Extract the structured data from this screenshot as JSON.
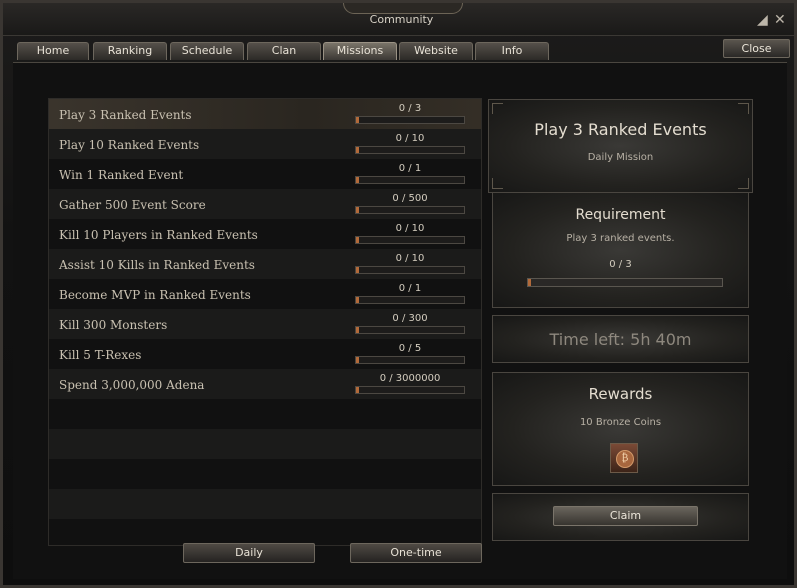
{
  "window": {
    "title": "Community",
    "minimize_glyph": "◢",
    "close_glyph": "✕"
  },
  "tabs": [
    {
      "label": "Home"
    },
    {
      "label": "Ranking"
    },
    {
      "label": "Schedule"
    },
    {
      "label": "Clan"
    },
    {
      "label": "Missions",
      "active": true
    },
    {
      "label": "Website"
    },
    {
      "label": "Info"
    }
  ],
  "close_button": {
    "label": "Close"
  },
  "missions": [
    {
      "name": "Play 3 Ranked Events",
      "progress": "0 / 3",
      "fraction": 0
    },
    {
      "name": "Play 10 Ranked Events",
      "progress": "0 / 10",
      "fraction": 0
    },
    {
      "name": "Win 1 Ranked Event",
      "progress": "0 / 1",
      "fraction": 0
    },
    {
      "name": "Gather 500 Event Score",
      "progress": "0 / 500",
      "fraction": 0
    },
    {
      "name": "Kill 10 Players in Ranked Events",
      "progress": "0 / 10",
      "fraction": 0
    },
    {
      "name": "Assist 10 Kills in Ranked Events",
      "progress": "0 / 10",
      "fraction": 0
    },
    {
      "name": "Become MVP in Ranked Events",
      "progress": "0 / 1",
      "fraction": 0
    },
    {
      "name": "Kill 300 Monsters",
      "progress": "0 / 300",
      "fraction": 0
    },
    {
      "name": "Kill 5 T-Rexes",
      "progress": "0 / 5",
      "fraction": 0
    },
    {
      "name": "Spend 3,000,000 Adena",
      "progress": "0 / 3000000",
      "fraction": 0
    }
  ],
  "list_buttons": {
    "daily": "Daily",
    "one_time": "One-time"
  },
  "detail": {
    "title": "Play 3 Ranked Events",
    "subtitle": "Daily Mission",
    "requirement_heading": "Requirement",
    "requirement_text": "Play 3 ranked events.",
    "requirement_progress": "0 / 3",
    "requirement_fraction": 0,
    "time_left": "Time left: 5h 40m",
    "rewards_heading": "Rewards",
    "reward_text": "10 Bronze Coins",
    "claim_label": "Claim"
  },
  "colors": {
    "progress_fill": "#b26a3a",
    "selected_row": "#3a342c"
  },
  "icons": {
    "reward": "bronze-coin-icon"
  }
}
